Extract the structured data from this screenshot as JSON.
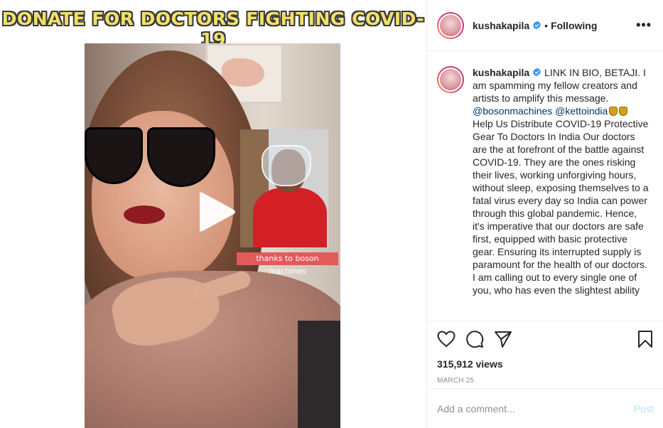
{
  "media": {
    "banner_text": "DONATE FOR DOCTORS FIGHTING COVID-19",
    "overlay_caption": "thanks to boson machines",
    "play_icon": "play-icon"
  },
  "header": {
    "username": "kushakapila",
    "separator": "•",
    "follow_status": "Following",
    "more_label": "•••",
    "verified_icon": "verified-badge-icon"
  },
  "caption": {
    "username": "kushakapila",
    "intro": " LINK IN BIO, BETAJI. I am spamming my fellow creators and artists to amplify this message.",
    "mention1": "@bosonmachines",
    "mention2": "@kettoindia",
    "body": "Help Us Distribute COVID-19 Protective Gear To Doctors In India Our doctors are the at forefront of the battle against COVID-19. They are the ones risking their lives, working unforgiving hours, without sleep, exposing themselves to a fatal virus every day so India can power through this global pandemic. Hence, it's imperative that our doctors are safe first, equipped with basic protective gear. Ensuring its interrupted supply is paramount for the health of our doctors.",
    "body2": "I am calling out to every single one of you, who has even the slightest ability"
  },
  "actions": {
    "icons": [
      "heart-icon",
      "comment-icon",
      "share-icon",
      "bookmark-icon"
    ],
    "views": "315,912 views",
    "date": "MARCH 25"
  },
  "comment": {
    "placeholder": "Add a comment...",
    "post_label": "Post"
  },
  "colors": {
    "accent_link": "#00376b",
    "verified_blue": "#3897f0",
    "post_disabled": "#b2dffc",
    "banner_yellow": "#f2e06a"
  }
}
